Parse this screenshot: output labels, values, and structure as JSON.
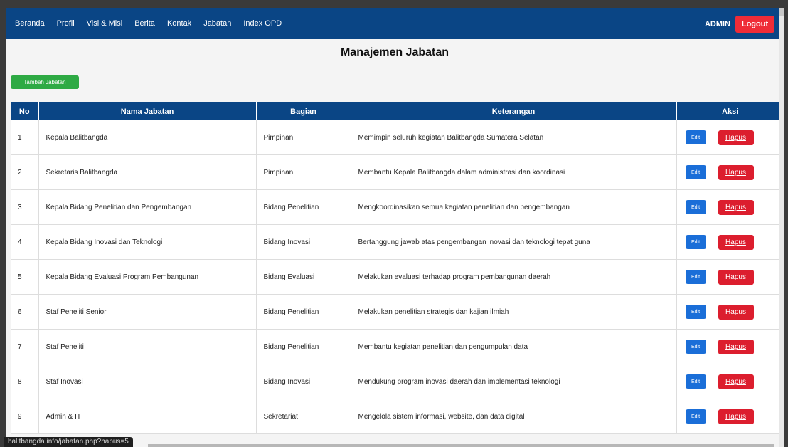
{
  "nav": {
    "links": [
      "Beranda",
      "Profil",
      "Visi & Misi",
      "Berita",
      "Kontak",
      "Jabatan",
      "Index OPD"
    ],
    "admin_label": "ADMIN",
    "logout_label": "Logout"
  },
  "page": {
    "title": "Manajemen Jabatan",
    "add_button_label": "Tambah Jabatan"
  },
  "table": {
    "headers": [
      "No",
      "Nama Jabatan",
      "Bagian",
      "Keterangan",
      "Aksi"
    ],
    "edit_label": "Edit",
    "delete_label": "Hapus",
    "rows": [
      {
        "no": "1",
        "nama": "Kepala Balitbangda",
        "bagian": "Pimpinan",
        "keterangan": "Memimpin seluruh kegiatan Balitbangda Sumatera Selatan"
      },
      {
        "no": "2",
        "nama": "Sekretaris Balitbangda",
        "bagian": "Pimpinan",
        "keterangan": "Membantu Kepala Balitbangda dalam administrasi dan koordinasi"
      },
      {
        "no": "3",
        "nama": "Kepala Bidang Penelitian dan Pengembangan",
        "bagian": "Bidang Penelitian",
        "keterangan": "Mengkoordinasikan semua kegiatan penelitian dan pengembangan"
      },
      {
        "no": "4",
        "nama": "Kepala Bidang Inovasi dan Teknologi",
        "bagian": "Bidang Inovasi",
        "keterangan": "Bertanggung jawab atas pengembangan inovasi dan teknologi tepat guna"
      },
      {
        "no": "5",
        "nama": "Kepala Bidang Evaluasi Program Pembangunan",
        "bagian": "Bidang Evaluasi",
        "keterangan": "Melakukan evaluasi terhadap program pembangunan daerah"
      },
      {
        "no": "6",
        "nama": "Staf Peneliti Senior",
        "bagian": "Bidang Penelitian",
        "keterangan": "Melakukan penelitian strategis dan kajian ilmiah"
      },
      {
        "no": "7",
        "nama": "Staf Peneliti",
        "bagian": "Bidang Penelitian",
        "keterangan": "Membantu kegiatan penelitian dan pengumpulan data"
      },
      {
        "no": "8",
        "nama": "Staf Inovasi",
        "bagian": "Bidang Inovasi",
        "keterangan": "Mendukung program inovasi daerah dan implementasi teknologi"
      },
      {
        "no": "9",
        "nama": "Admin & IT",
        "bagian": "Sekretariat",
        "keterangan": "Mengelola sistem informasi, website, dan data digital"
      }
    ]
  },
  "status_bar": {
    "hover_url": "balitbangda.info/jabatan.php?hapus=5"
  },
  "colors": {
    "navbar": "#0a4585",
    "logout": "#ef2c37",
    "add_button": "#2eaa44",
    "edit_button": "#1a6ed8",
    "delete_button": "#dc1e2e"
  }
}
